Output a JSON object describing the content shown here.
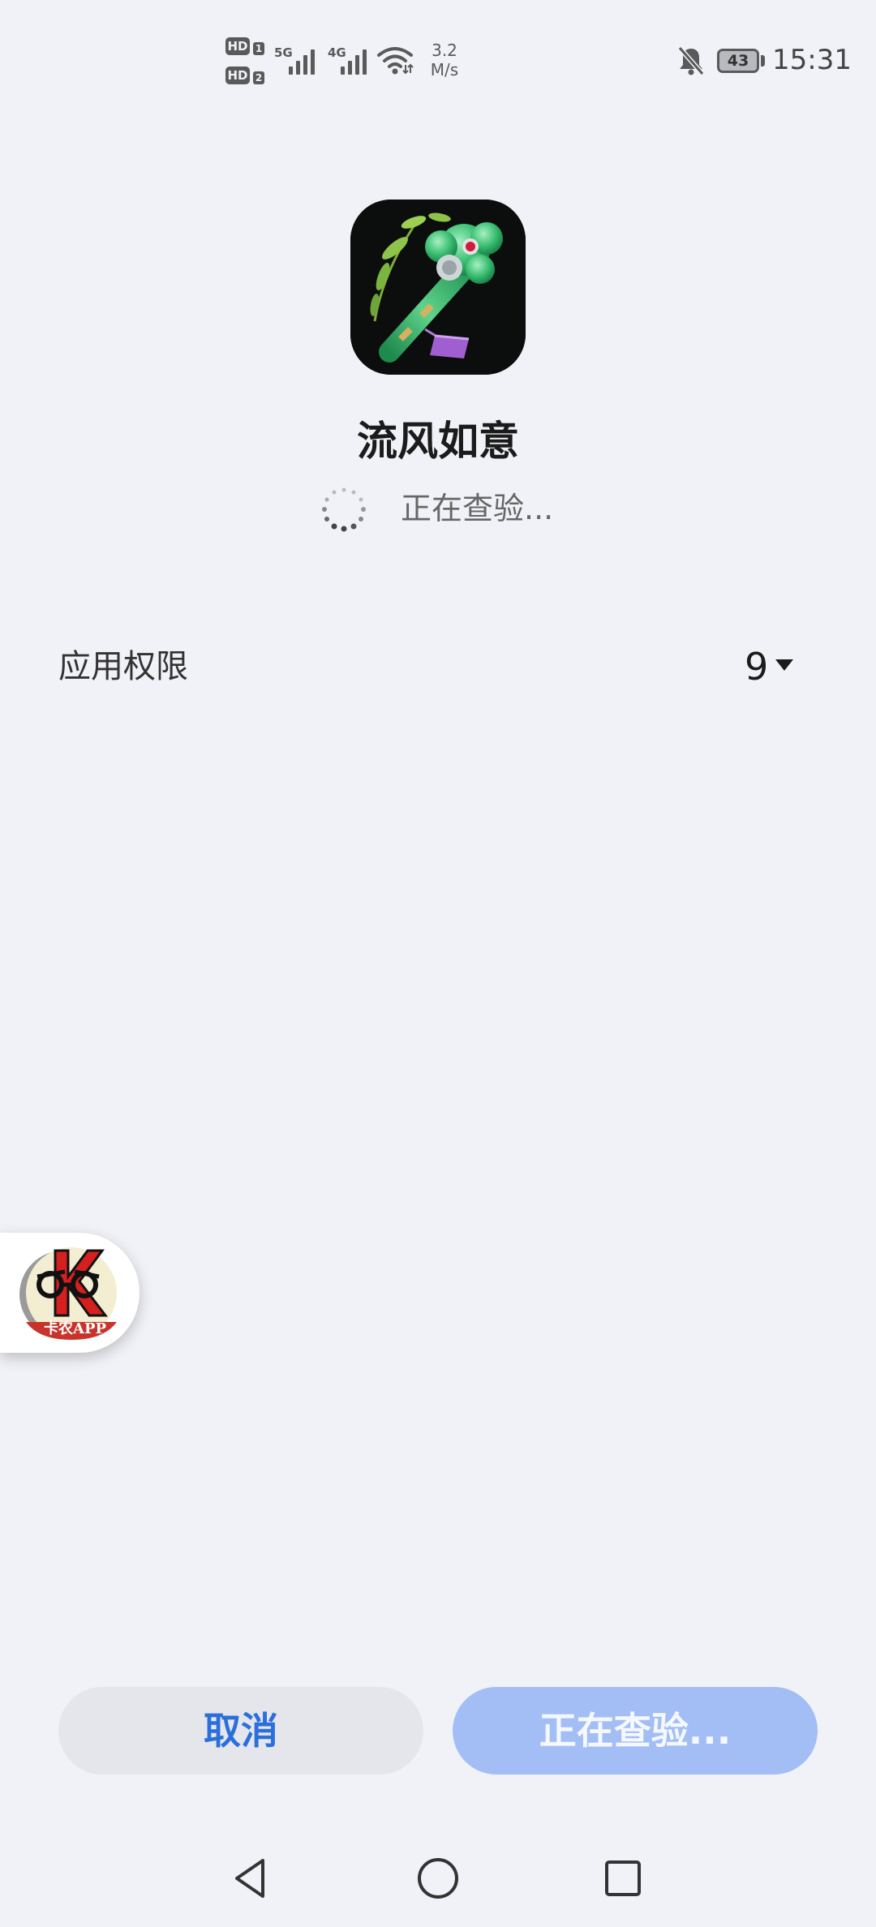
{
  "status_bar": {
    "hd1": "HD",
    "hd1_num": "1",
    "hd2": "HD",
    "hd2_num": "2",
    "net1": "5G",
    "net2": "4G",
    "speed_value": "3.2",
    "speed_unit": "M/s",
    "battery": "43",
    "time": "15:31",
    "icons": [
      "signal-icon",
      "wifi-icon",
      "bell-off-icon",
      "battery-icon"
    ]
  },
  "app": {
    "name": "流风如意",
    "status": "正在查验...",
    "icon": "ruyi-scepter-icon"
  },
  "permissions": {
    "label": "应用权限",
    "count": "9",
    "expand_icon": "caret-down-icon"
  },
  "floating_widget": {
    "label": "卡农APP",
    "icon": "kanong-logo"
  },
  "buttons": {
    "cancel": "取消",
    "verify": "正在查验..."
  },
  "nav": {
    "icons": [
      "back-icon",
      "home-icon",
      "recent-apps-icon"
    ]
  },
  "colors": {
    "background": "#f1f2f7",
    "accent": "#2a6fdb",
    "primary_disabled": "#a3bef5",
    "secondary_button": "#e5e6eb"
  }
}
